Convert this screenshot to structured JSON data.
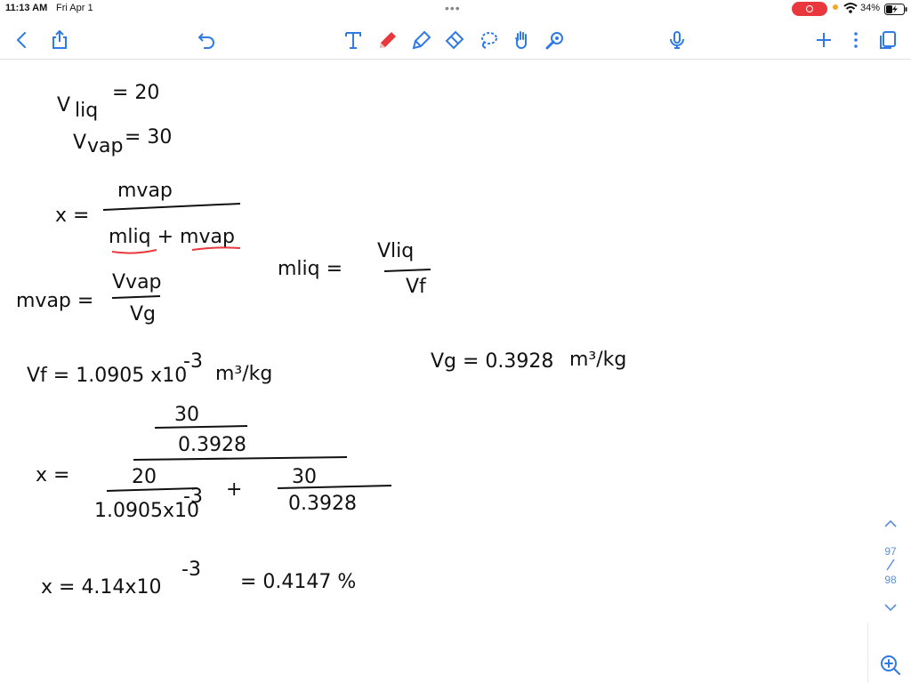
{
  "status_bar": {
    "time": "11:13 AM",
    "date": "Fri Apr 1",
    "battery": "34%"
  },
  "toolbar": {
    "left": [
      "back-icon",
      "share-icon",
      "undo-icon"
    ],
    "tools": [
      "text-tool-icon",
      "pen-icon",
      "highlighter-icon",
      "eraser-icon",
      "lasso-icon",
      "hand-icon",
      "laser-pointer-icon"
    ],
    "right": [
      "microphone-icon",
      "add-icon",
      "more-icon",
      "pages-icon"
    ],
    "accent": "#2f7ae5",
    "pen_color": "#e8383d"
  },
  "notes": {
    "line1_lhs": "V",
    "line1_sub": "liq",
    "line1_rhs": "= 20",
    "line2_lhs": "V",
    "line2_sub": "vap",
    "line2_rhs": "= 30",
    "eq3_lhs": "x =",
    "eq3_num": "mvap",
    "eq3_den": "mliq + mvap",
    "eq4_lhs": "mvap =",
    "eq4_num": "Vvap",
    "eq4_den": "Vg",
    "eq5_lhs": "mliq =",
    "eq5_num": "Vliq",
    "eq5_den": "Vf",
    "vf": "Vf = 1.0905 x10",
    "vf_exp": "-3",
    "vf_unit": "m³/kg",
    "vg": "Vg = 0.3928",
    "vg_unit": "m³/kg",
    "frac_top_num": "30",
    "frac_top_den": "0.3928",
    "x_lhs": "x =",
    "frac_bl_num": "20",
    "frac_bl_den": "1.0905x10",
    "frac_bl_exp": "-3",
    "plus": "+",
    "frac_br_num": "30",
    "frac_br_den": "0.3928",
    "result_lhs": "x = 4.14x10",
    "result_exp": "-3",
    "result_rhs": "= 0.4147 %"
  },
  "pager": {
    "current": "97",
    "total": "98"
  }
}
